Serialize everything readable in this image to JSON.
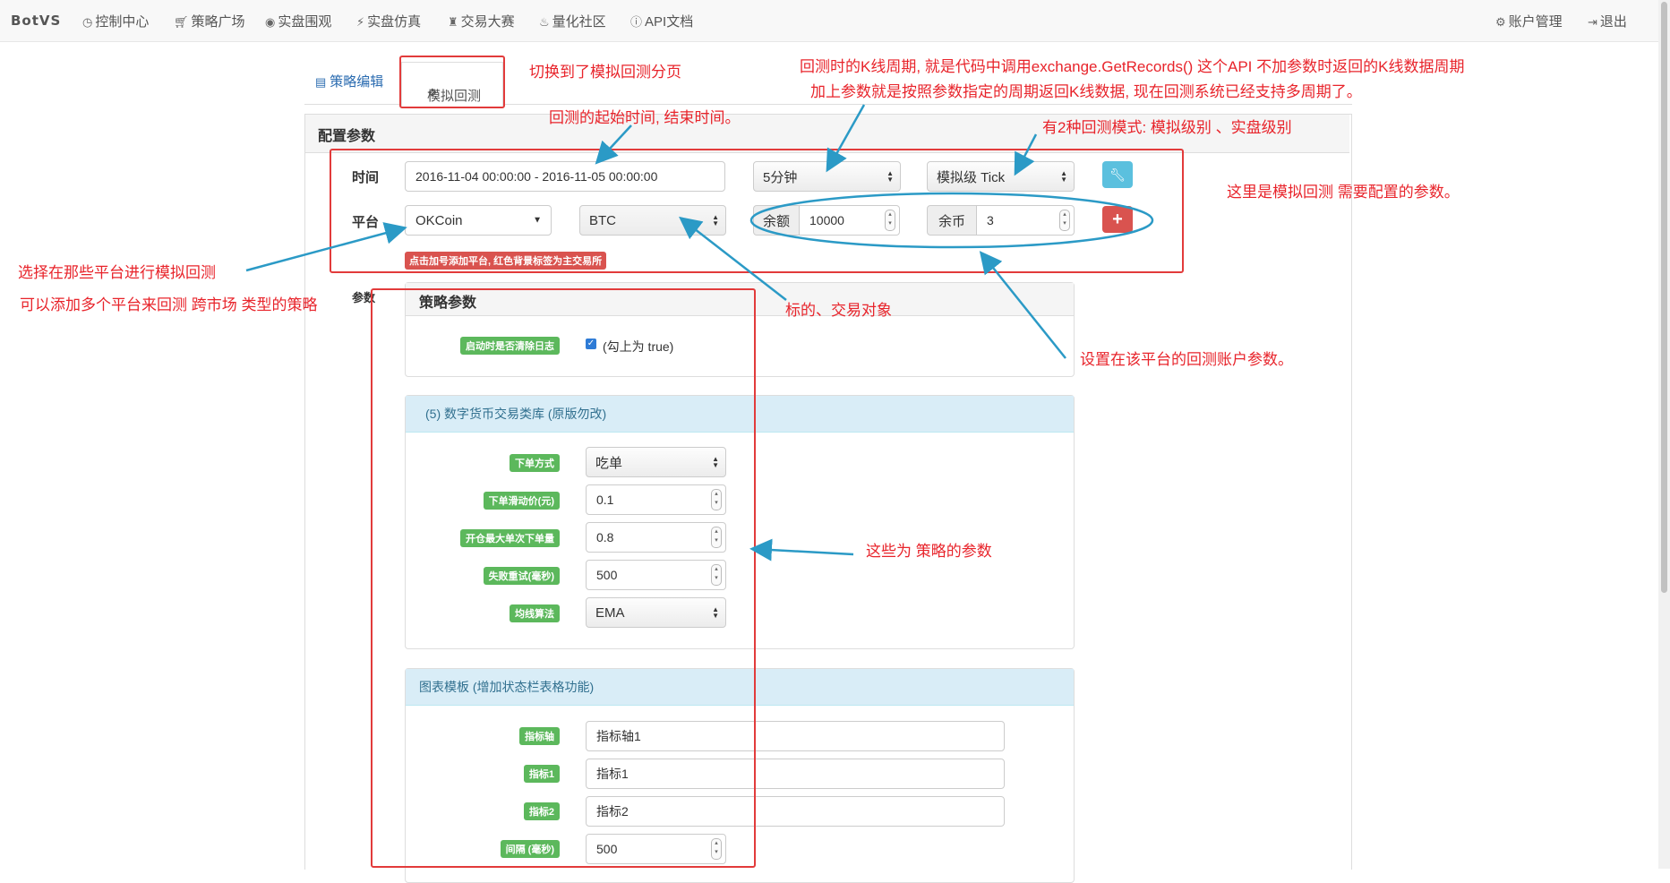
{
  "nav": {
    "brand": "BotVS",
    "items": [
      {
        "label": "控制中心",
        "icon": "clock-icon"
      },
      {
        "label": "策略广场",
        "icon": "cart-icon"
      },
      {
        "label": "实盘围观",
        "icon": "eye-icon"
      },
      {
        "label": "实盘仿真",
        "icon": "bolt-icon"
      },
      {
        "label": "交易大赛",
        "icon": "trophy-icon"
      },
      {
        "label": "量化社区",
        "icon": "fire-icon"
      },
      {
        "label": "API文档",
        "icon": "info-icon"
      }
    ],
    "account": "账户管理",
    "logout": "退出"
  },
  "tabs": {
    "edit": "策略编辑",
    "backtest": "模拟回测"
  },
  "config": {
    "title": "配置参数",
    "time_label": "时间",
    "time_range": "2016-11-04 00:00:00 - 2016-11-05 00:00:00",
    "period": "5分钟",
    "mode": "模拟级 Tick",
    "platform_label": "平台",
    "exchange": "OKCoin",
    "symbol": "BTC",
    "balance_label": "余额",
    "balance": "10000",
    "stocks_label": "余币",
    "stocks": "3",
    "add_hint": "点击加号添加平台, 红色背景标签为主交易所",
    "params_label": "参数"
  },
  "strategy_params": {
    "title": "策略参数",
    "clear_log_label": "启动时是否清除日志",
    "clear_log_text": "(勾上为 true)",
    "clear_log_checked": true
  },
  "lib_params": {
    "title": "(5) 数字货币交易类库 (原版勿改)",
    "rows": [
      {
        "label": "下单方式",
        "value": "吃单",
        "kind": "select"
      },
      {
        "label": "下单滑动价(元)",
        "value": "0.1",
        "kind": "number"
      },
      {
        "label": "开仓最大单次下单量",
        "value": "0.8",
        "kind": "number"
      },
      {
        "label": "失败重试(毫秒)",
        "value": "500",
        "kind": "number"
      },
      {
        "label": "均线算法",
        "value": "EMA",
        "kind": "select"
      }
    ]
  },
  "chart_params": {
    "title": "图表模板 (增加状态栏表格功能)",
    "rows": [
      {
        "label": "指标轴",
        "value": "指标轴1",
        "kind": "text"
      },
      {
        "label": "指标1",
        "value": "指标1",
        "kind": "text"
      },
      {
        "label": "指标2",
        "value": "指标2",
        "kind": "text"
      },
      {
        "label": "间隔 (毫秒)",
        "value": "500",
        "kind": "number"
      }
    ]
  },
  "annotations": {
    "switch_tab": "切换到了模拟回测分页",
    "period_line1": "回测时的K线周期, 就是代码中调用exchange.GetRecords() 这个API 不加参数时返回的K线数据周期",
    "period_line2": "加上参数就是按照参数指定的周期返回K线数据, 现在回测系统已经支持多周期了。",
    "time_range": "回测的起始时间, 结束时间。",
    "modes": "有2种回测模式:  模拟级别 、实盘级别",
    "config_needed": "这里是模拟回测 需要配置的参数。",
    "platform_line1": "选择在那些平台进行模拟回测",
    "platform_line2": "可以添加多个平台来回测 跨市场 类型的策略",
    "symbol": "标的、交易对象",
    "account_params": "设置在该平台的回测账户参数。",
    "strategy_params": "这些为 策略的参数"
  },
  "colors": {
    "annotation": "#e8242b",
    "arrow": "#2b9ac6",
    "tag_green": "#5cb85c",
    "tag_red": "#d9534f",
    "link_blue": "#2a6bb0"
  }
}
